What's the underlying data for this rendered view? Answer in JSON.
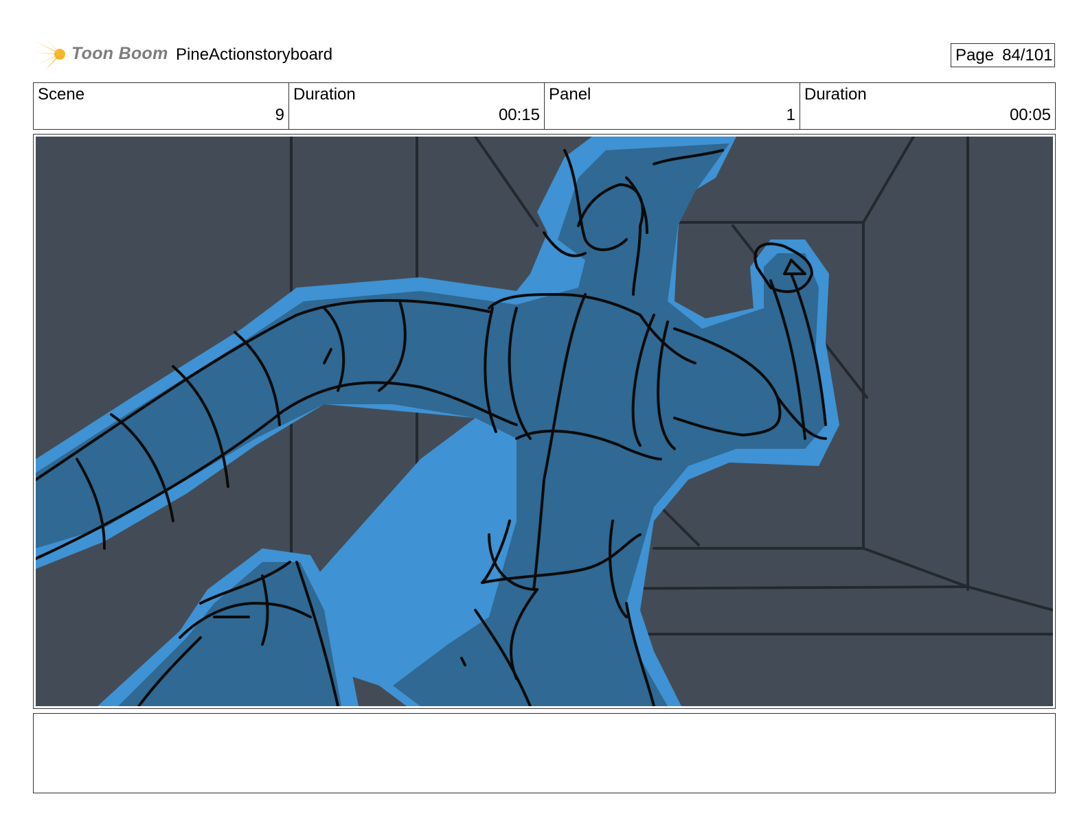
{
  "header": {
    "logo_text": "Toon Boom",
    "project_title": "PineActionstoryboard",
    "page_label": "Page",
    "page_number": "84/101"
  },
  "info": {
    "scene_label": "Scene",
    "scene_value": "9",
    "scene_duration_label": "Duration",
    "scene_duration_value": "00:15",
    "panel_label": "Panel",
    "panel_value": "1",
    "panel_duration_label": "Duration",
    "panel_duration_value": "00:05"
  },
  "panel": {
    "icon": "storyboard-drawing"
  },
  "notes": {
    "text": ""
  },
  "colors": {
    "logo_accent": "#f7b52c",
    "background_wall": "#434c56",
    "character_fill": "#2f6994",
    "character_glow": "#3f92d3"
  }
}
